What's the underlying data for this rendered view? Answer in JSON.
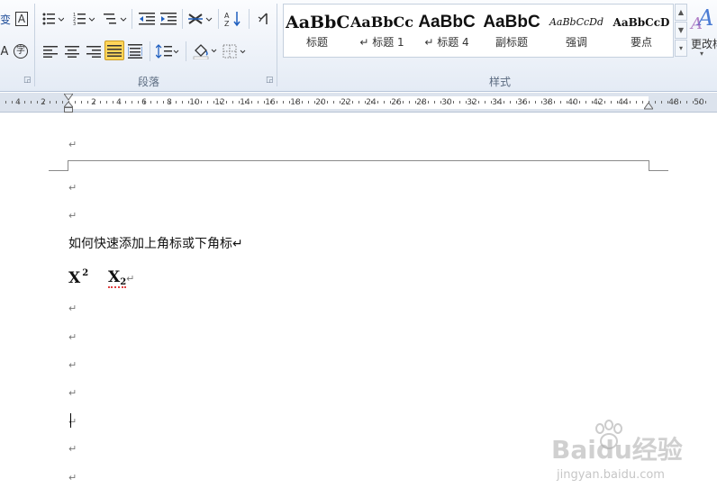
{
  "ribbon": {
    "paragraph_group_label": "段落",
    "styles_group_label": "样式",
    "font_sample_glyph": "A",
    "circle_char_glyph": "字",
    "change_styles_label": "更改样",
    "styles": [
      {
        "sample": "AaBbC",
        "name": "标题"
      },
      {
        "sample": "AaBbCc",
        "name": "↵ 标题 1"
      },
      {
        "sample": "AaBbC",
        "name": "↵ 标题 4"
      },
      {
        "sample": "AaBbC",
        "name": "副标题"
      },
      {
        "sample": "AaBbCcDd",
        "name": "强调"
      },
      {
        "sample": "AaBbCcD",
        "name": "要点"
      }
    ],
    "active_alignment": "justify"
  },
  "ruler": {
    "labels": [
      "4",
      "2",
      "2",
      "4",
      "6",
      "8",
      "10",
      "12",
      "14",
      "16",
      "18",
      "20",
      "22",
      "24",
      "26",
      "28",
      "30",
      "32",
      "34",
      "36",
      "38",
      "40",
      "42",
      "44",
      "48",
      "50"
    ]
  },
  "document": {
    "paragraph_mark": "↵",
    "body_text": "如何快速添加上角标或下角标↵",
    "superscript_example": {
      "base": "X",
      "script": "2"
    },
    "subscript_example": {
      "base": "X",
      "script": "2"
    }
  },
  "watermark": {
    "logo": "Baidu经验",
    "url": "jingyan.baidu.com"
  }
}
